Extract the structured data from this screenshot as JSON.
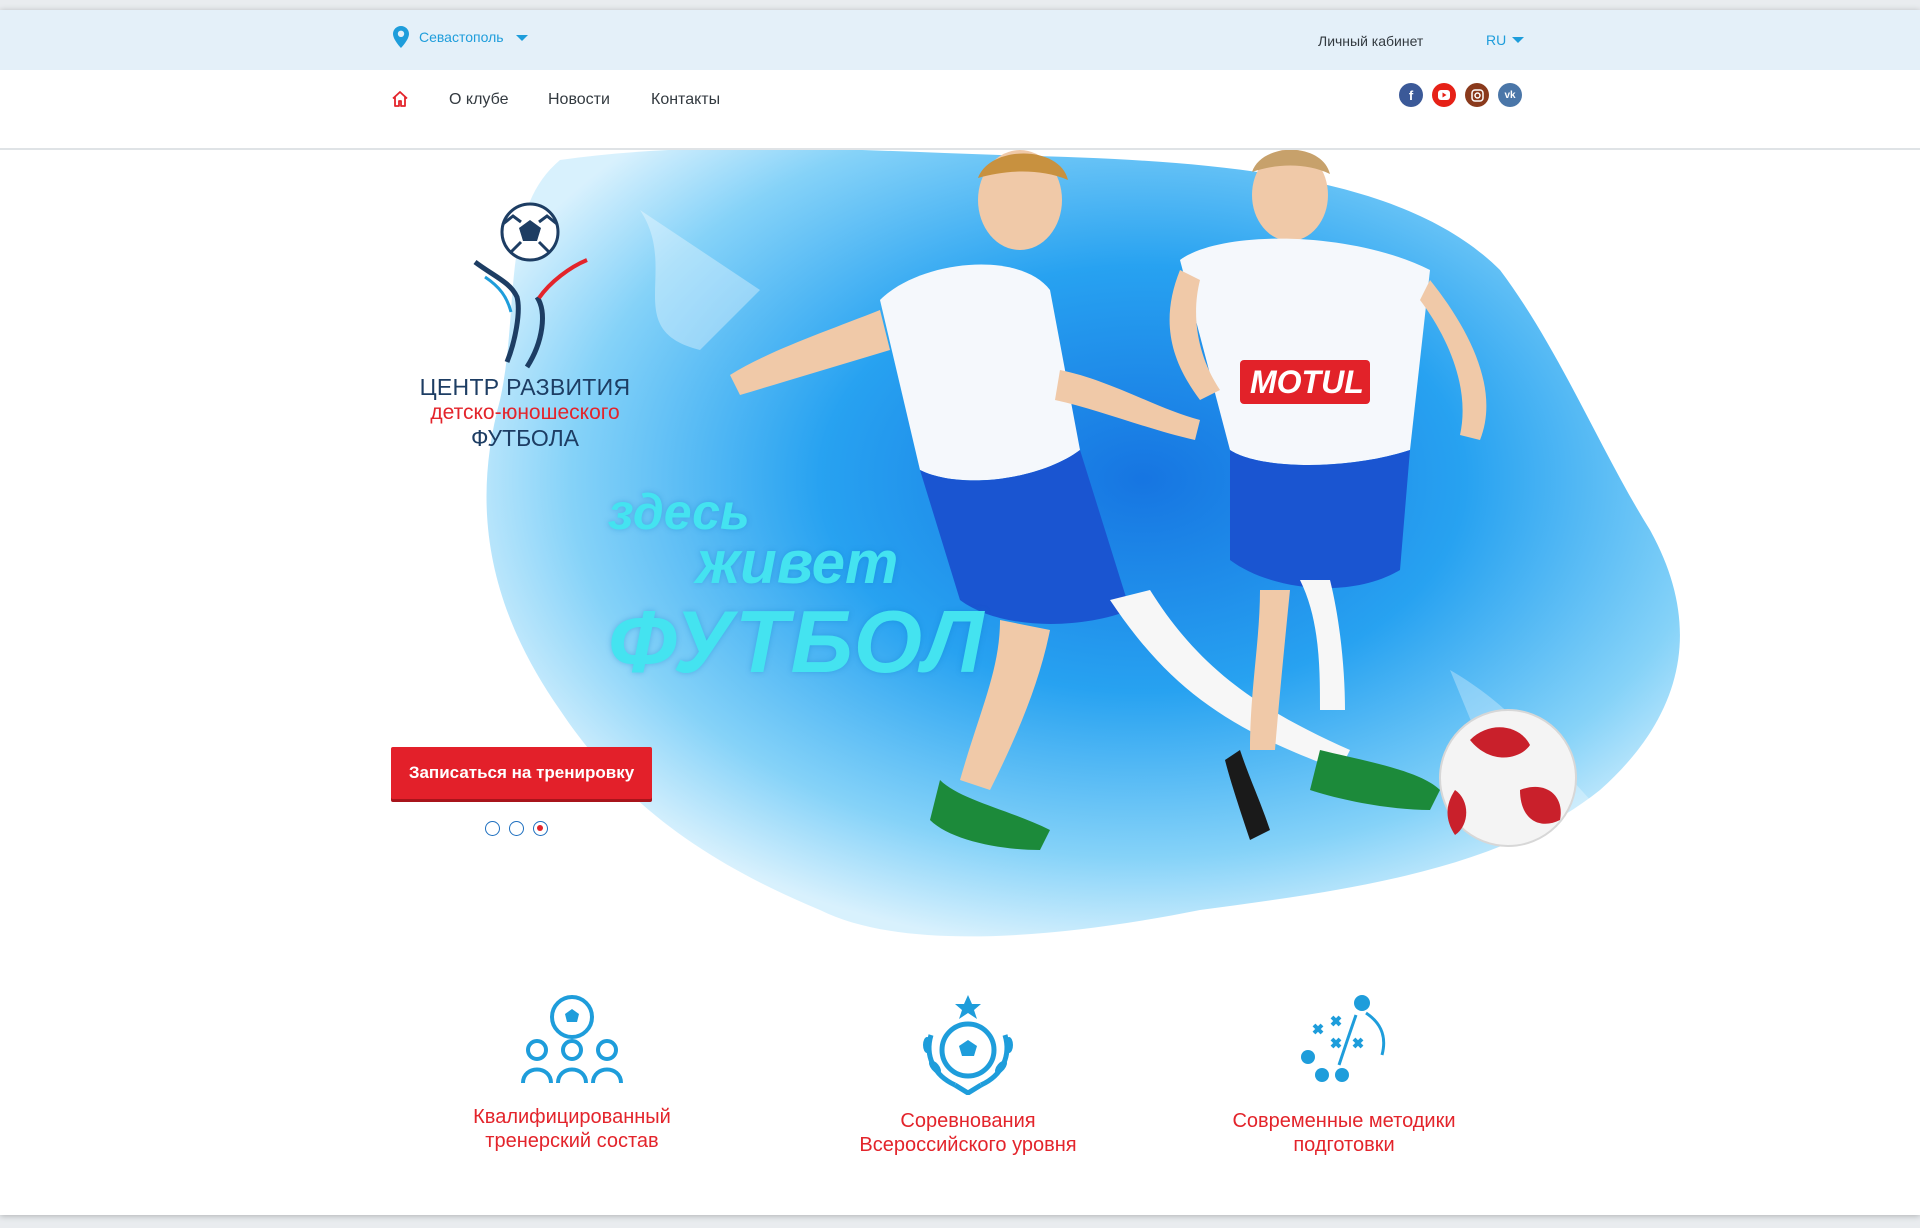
{
  "topbar": {
    "city": "Севастополь",
    "cabinet": "Личный кабинет",
    "lang": "RU"
  },
  "nav": {
    "items": [
      "О клубе",
      "Новости",
      "Контакты"
    ],
    "socials": [
      "facebook-icon",
      "youtube-icon",
      "instagram-icon",
      "vk-icon"
    ]
  },
  "hero": {
    "logo": {
      "line1": "ЦЕНТР РАЗВИТИЯ",
      "line2": "детско-юношеского",
      "line3": "ФУТБОЛА"
    },
    "slogan": {
      "line1": "здесь",
      "line2": "живет",
      "line3": "ФУТБОЛ"
    },
    "cta": "Записаться на тренировку",
    "slides": {
      "count": 3,
      "active": 3
    }
  },
  "features": [
    {
      "icon": "team-icon",
      "line1": "Квалифицированный",
      "line2": "тренерский состав"
    },
    {
      "icon": "trophy-icon",
      "line1": "Соревнования",
      "line2": "Всероссийского уровня"
    },
    {
      "icon": "tactics-icon",
      "line1": "Современные методики",
      "line2": "подготовки"
    }
  ],
  "colors": {
    "accent": "#e3242b",
    "brand_blue": "#1e9ddb",
    "navy": "#1d3d63",
    "topbar_bg": "#e4f0f9"
  }
}
